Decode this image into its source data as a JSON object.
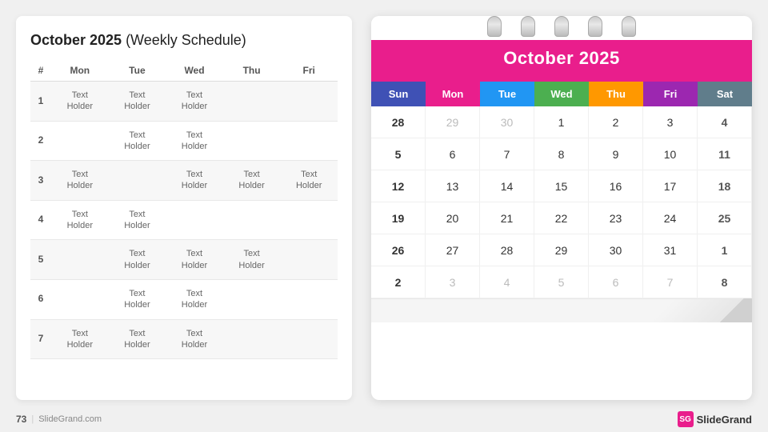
{
  "page": {
    "number": "73",
    "website": "SlideGrand.com",
    "brand": "SlideGrand"
  },
  "weekly_schedule": {
    "title_bold": "October 2025",
    "title_rest": " (Weekly Schedule)",
    "columns": [
      "#",
      "Mon",
      "Tue",
      "Wed",
      "Thu",
      "Fri"
    ],
    "rows": [
      {
        "num": "1",
        "mon": "Text\nHolder",
        "tue": "Text\nHolder",
        "wed": "Text\nHolder",
        "thu": "",
        "fri": ""
      },
      {
        "num": "2",
        "mon": "",
        "tue": "Text\nHolder",
        "wed": "Text\nHolder",
        "thu": "",
        "fri": ""
      },
      {
        "num": "3",
        "mon": "Text\nHolder",
        "tue": "",
        "wed": "Text\nHolder",
        "thu": "Text\nHolder",
        "fri": "Text\nHolder"
      },
      {
        "num": "4",
        "mon": "Text\nHolder",
        "tue": "Text\nHolder",
        "wed": "",
        "thu": "",
        "fri": ""
      },
      {
        "num": "5",
        "mon": "",
        "tue": "Text\nHolder",
        "wed": "Text\nHolder",
        "thu": "Text\nHolder",
        "fri": ""
      },
      {
        "num": "6",
        "mon": "",
        "tue": "Text\nHolder",
        "wed": "Text\nHolder",
        "thu": "",
        "fri": ""
      },
      {
        "num": "7",
        "mon": "Text\nHolder",
        "tue": "Text\nHolder",
        "wed": "Text\nHolder",
        "thu": "",
        "fri": ""
      }
    ]
  },
  "calendar": {
    "month_title": "October 2025",
    "day_headers": [
      "Sun",
      "Mon",
      "Tue",
      "Wed",
      "Thu",
      "Fri",
      "Sat"
    ],
    "rings_count": 5,
    "weeks": [
      [
        "28",
        "29",
        "30",
        "1",
        "2",
        "3",
        "4"
      ],
      [
        "5",
        "6",
        "7",
        "8",
        "9",
        "10",
        "11"
      ],
      [
        "12",
        "13",
        "14",
        "15",
        "16",
        "17",
        "18"
      ],
      [
        "19",
        "20",
        "21",
        "22",
        "23",
        "24",
        "25"
      ],
      [
        "26",
        "27",
        "28",
        "29",
        "30",
        "31",
        "1"
      ],
      [
        "2",
        "3",
        "4",
        "5",
        "6",
        "7",
        "8"
      ]
    ],
    "other_month_dates": [
      "28",
      "29",
      "30",
      "1",
      "2",
      "3",
      "4",
      "5",
      "6",
      "7",
      "8"
    ],
    "first_week_others": [
      "28",
      "29",
      "30"
    ],
    "last_week_others": [
      "1",
      "2",
      "3",
      "4",
      "5",
      "6",
      "7",
      "8"
    ]
  }
}
